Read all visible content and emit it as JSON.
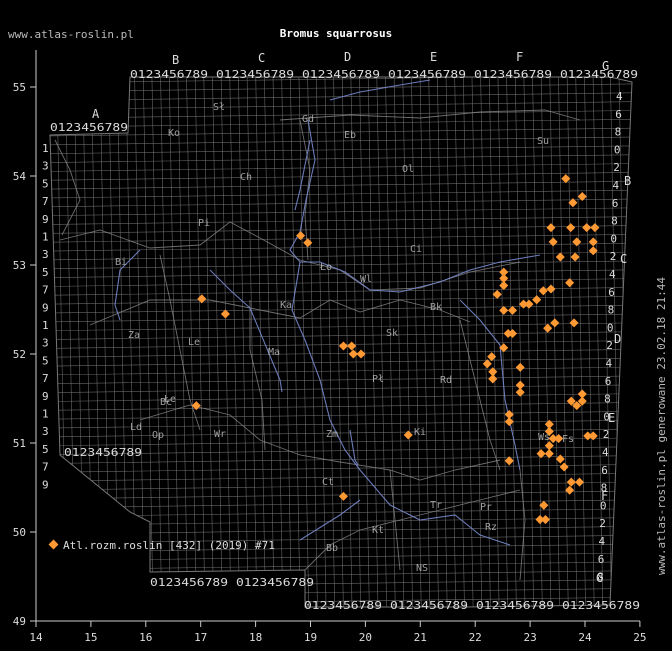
{
  "header": {
    "site_url": "www.atlas-roslin.pl",
    "title": "Bromus squarrosus"
  },
  "side_note": "www.atlas-roslin.pl generowane 23.02.18 21:44",
  "legend": {
    "label": "Atl.rozm.roslin [432] (2019) #71",
    "marker_color": "#ff9933"
  },
  "axes": {
    "lon_ticks": [
      "14",
      "15",
      "16",
      "17",
      "18",
      "19",
      "20",
      "21",
      "22",
      "23",
      "24",
      "25"
    ],
    "lat_ticks": [
      "49",
      "50",
      "51",
      "52",
      "53",
      "54",
      "55"
    ]
  },
  "grid_labels": {
    "top_columns": [
      "A",
      "B",
      "C",
      "D",
      "E",
      "F",
      "G"
    ],
    "digits_row": "0123456789",
    "right_letters": [
      "B",
      "C",
      "D",
      "E",
      "F",
      "G"
    ],
    "left_digits": [
      "1",
      "3",
      "5",
      "7",
      "9",
      "1",
      "3",
      "5",
      "7",
      "9",
      "1",
      "3",
      "5",
      "7",
      "9",
      "1",
      "3",
      "5",
      "7",
      "9"
    ]
  },
  "region_codes": [
    "Sł",
    "Gd",
    "Eb",
    "Ko",
    "Ch",
    "Ol",
    "Su",
    "Pi",
    "Ci",
    "Bi",
    "Ło",
    "Wl",
    "Ka",
    "Ma",
    "Pł",
    "Bk",
    "Le",
    "Za",
    "Bc",
    "Sk",
    "Rd",
    "Ws",
    "Wr",
    "Łe",
    "Ld",
    "Ki",
    "Op",
    "Zm",
    "Ct",
    "Kt",
    "Tr",
    "Pr",
    "Bb",
    "NS",
    "Rz",
    "Fs"
  ],
  "colors": {
    "background": "#000000",
    "grid": "#777777",
    "rivers": "#7788cc",
    "borders": "#888888",
    "marker": "#ff9933",
    "text": "#dddddd"
  },
  "chart_data": {
    "type": "scatter",
    "title": "Bromus squarrosus",
    "xlim": [
      14,
      25
    ],
    "ylim": [
      49,
      55.5
    ],
    "series": [
      {
        "name": "Atl.rozm.roslin [432] (2019) #71",
        "points": [
          [
            23.65,
            53.97
          ],
          [
            23.95,
            53.77
          ],
          [
            23.78,
            53.7
          ],
          [
            23.38,
            53.42
          ],
          [
            23.74,
            53.42
          ],
          [
            24.03,
            53.42
          ],
          [
            24.18,
            53.42
          ],
          [
            23.42,
            53.26
          ],
          [
            23.85,
            53.26
          ],
          [
            24.15,
            53.26
          ],
          [
            23.55,
            53.09
          ],
          [
            23.82,
            53.09
          ],
          [
            24.15,
            53.16
          ],
          [
            18.82,
            53.33
          ],
          [
            18.95,
            53.25
          ],
          [
            22.52,
            52.92
          ],
          [
            22.52,
            52.85
          ],
          [
            22.52,
            52.77
          ],
          [
            22.4,
            52.67
          ],
          [
            22.68,
            52.49
          ],
          [
            22.52,
            52.49
          ],
          [
            22.98,
            52.56
          ],
          [
            22.88,
            52.56
          ],
          [
            23.12,
            52.61
          ],
          [
            23.24,
            52.71
          ],
          [
            23.38,
            52.73
          ],
          [
            23.72,
            52.8
          ],
          [
            23.45,
            52.35
          ],
          [
            23.32,
            52.29
          ],
          [
            23.8,
            52.35
          ],
          [
            22.6,
            52.23
          ],
          [
            22.68,
            52.23
          ],
          [
            22.52,
            52.07
          ],
          [
            22.3,
            51.97
          ],
          [
            22.22,
            51.89
          ],
          [
            22.32,
            51.8
          ],
          [
            22.32,
            51.72
          ],
          [
            22.82,
            51.85
          ],
          [
            22.82,
            51.65
          ],
          [
            22.82,
            51.57
          ],
          [
            23.75,
            51.47
          ],
          [
            23.85,
            51.42
          ],
          [
            23.95,
            51.47
          ],
          [
            23.95,
            51.55
          ],
          [
            22.62,
            51.32
          ],
          [
            22.62,
            51.24
          ],
          [
            23.35,
            51.21
          ],
          [
            23.35,
            51.13
          ],
          [
            23.42,
            51.05
          ],
          [
            23.52,
            51.05
          ],
          [
            23.35,
            50.97
          ],
          [
            23.35,
            50.88
          ],
          [
            23.2,
            50.88
          ],
          [
            23.55,
            50.82
          ],
          [
            24.05,
            51.08
          ],
          [
            24.15,
            51.08
          ],
          [
            23.62,
            50.73
          ],
          [
            22.62,
            50.8
          ],
          [
            23.75,
            50.56
          ],
          [
            23.9,
            50.56
          ],
          [
            23.72,
            50.47
          ],
          [
            23.18,
            50.14
          ],
          [
            23.28,
            50.14
          ],
          [
            23.25,
            50.3
          ],
          [
            19.6,
            52.09
          ],
          [
            19.75,
            52.09
          ],
          [
            19.78,
            52.0
          ],
          [
            19.92,
            52.0
          ],
          [
            17.02,
            52.62
          ],
          [
            17.45,
            52.45
          ],
          [
            16.92,
            51.42
          ],
          [
            20.78,
            51.09
          ],
          [
            19.6,
            50.4
          ]
        ]
      }
    ]
  }
}
